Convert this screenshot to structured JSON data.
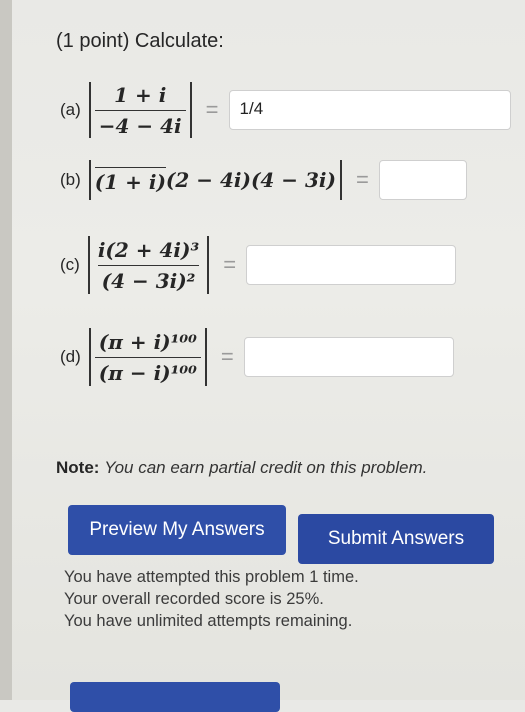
{
  "problem": {
    "title": "(1 point) Calculate:",
    "equals": "="
  },
  "parts": {
    "a": {
      "label": "(a)",
      "numerator": "1 + i",
      "denominator": "−4 − 4i",
      "answer": "1/4"
    },
    "b": {
      "label": "(b)",
      "expr_overlined": "(1 + i)",
      "expr_rest": "(2 − 4i)(4 − 3i)",
      "answer": ""
    },
    "c": {
      "label": "(c)",
      "numerator": "i(2 + 4i)³",
      "denominator": "(4 − 3i)²",
      "answer": ""
    },
    "d": {
      "label": "(d)",
      "numerator": "(π + i)¹⁰⁰",
      "denominator": "(π − i)¹⁰⁰",
      "answer": ""
    }
  },
  "note": {
    "label": "Note:",
    "text": "You can earn partial credit on this problem."
  },
  "buttons": {
    "preview": "Preview My Answers",
    "submit": "Submit Answers"
  },
  "status": {
    "line1": "You have attempted this problem 1 time.",
    "line2": "Your overall recorded score is 25%.",
    "line3": "You have unlimited attempts remaining."
  },
  "colors": {
    "button": "#2f4fa8",
    "background": "#e9e9e6"
  }
}
